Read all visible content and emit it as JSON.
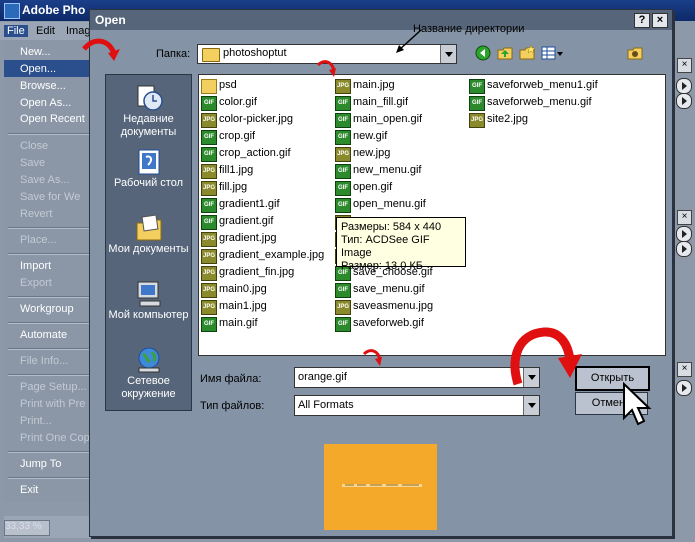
{
  "photoshop": {
    "title": "Adobe Pho",
    "menubar": [
      "File",
      "Edit",
      "Imag"
    ],
    "menu": [
      {
        "label": "New...",
        "enabled": true
      },
      {
        "label": "Open...",
        "enabled": true
      },
      {
        "label": "Browse...",
        "enabled": true
      },
      {
        "label": "Open As...",
        "enabled": true
      },
      {
        "label": "Open Recent",
        "enabled": true
      },
      {
        "label": "Close",
        "enabled": false
      },
      {
        "label": "Save",
        "enabled": false
      },
      {
        "label": "Save As...",
        "enabled": false
      },
      {
        "label": "Save for We",
        "enabled": false
      },
      {
        "label": "Revert",
        "enabled": false
      },
      {
        "label": "Place...",
        "enabled": false
      },
      {
        "label": "Import",
        "enabled": true
      },
      {
        "label": "Export",
        "enabled": false
      },
      {
        "label": "Workgroup",
        "enabled": true
      },
      {
        "label": "Automate",
        "enabled": true
      },
      {
        "label": "File Info...",
        "enabled": false
      },
      {
        "label": "Page Setup...",
        "enabled": false
      },
      {
        "label": "Print with Pre",
        "enabled": false
      },
      {
        "label": "Print...",
        "enabled": false
      },
      {
        "label": "Print One Cop",
        "enabled": false
      },
      {
        "label": "Jump To",
        "enabled": true
      },
      {
        "label": "Exit",
        "enabled": true
      }
    ],
    "zoom": "33,33 %"
  },
  "dialog": {
    "title": "Open",
    "help_btn": "?",
    "close_btn": "×",
    "look_in_label": "Папка:",
    "look_in_value": "photoshoptut",
    "annotation": "Название директории",
    "places": [
      {
        "label": "Недавние документы",
        "icon": "recent-documents-icon"
      },
      {
        "label": "Рабочий стол",
        "icon": "desktop-icon"
      },
      {
        "label": "Мои документы",
        "icon": "my-documents-icon"
      },
      {
        "label": "Мой компьютер",
        "icon": "my-computer-icon"
      },
      {
        "label": "Сетевое окружение",
        "icon": "network-icon"
      }
    ],
    "files_col1": [
      {
        "name": "psd",
        "type": "folder"
      },
      {
        "name": "color.gif",
        "type": "gif"
      },
      {
        "name": "color-picker.jpg",
        "type": "jpg"
      },
      {
        "name": "crop.gif",
        "type": "gif"
      },
      {
        "name": "crop_action.gif",
        "type": "gif"
      },
      {
        "name": "fill1.jpg",
        "type": "jpg"
      },
      {
        "name": "fill.jpg",
        "type": "jpg"
      },
      {
        "name": "gradient1.gif",
        "type": "gif"
      },
      {
        "name": "gradient.gif",
        "type": "gif"
      },
      {
        "name": "gradient.jpg",
        "type": "jpg"
      },
      {
        "name": "gradient_example.jpg",
        "type": "jpg"
      },
      {
        "name": "gradient_fin.jpg",
        "type": "jpg"
      },
      {
        "name": "main0.jpg",
        "type": "jpg"
      },
      {
        "name": "main1.jpg",
        "type": "jpg"
      },
      {
        "name": "main.gif",
        "type": "gif"
      }
    ],
    "files_col2": [
      {
        "name": "main.jpg",
        "type": "jpg"
      },
      {
        "name": "main_fill.gif",
        "type": "gif"
      },
      {
        "name": "main_open.gif",
        "type": "gif"
      },
      {
        "name": "new.gif",
        "type": "gif"
      },
      {
        "name": "new.jpg",
        "type": "jpg"
      },
      {
        "name": "new_menu.gif",
        "type": "gif"
      },
      {
        "name": "open.gif",
        "type": "gif"
      },
      {
        "name": "open_menu.gif",
        "type": "gif"
      },
      {
        "name": "",
        "type": "jpg"
      },
      {
        "name": "",
        "type": "jpg"
      },
      {
        "name": "",
        "type": "jpg"
      },
      {
        "name": "save_choose.gif",
        "type": "gif"
      },
      {
        "name": "save_menu.gif",
        "type": "gif"
      },
      {
        "name": "saveasmenu.jpg",
        "type": "jpg"
      },
      {
        "name": "saveforweb.gif",
        "type": "gif"
      }
    ],
    "files_col3": [
      {
        "name": "saveforweb_menu1.gif",
        "type": "gif"
      },
      {
        "name": "saveforweb_menu.gif",
        "type": "gif"
      },
      {
        "name": "site2.jpg",
        "type": "jpg"
      }
    ],
    "tooltip": {
      "size": "Размеры: 584 x 440",
      "type": "Тип: ACDSee GIF Image",
      "filesize": "Размер: 13,0 КБ"
    },
    "file_name_label": "Имя файла:",
    "file_name_value": "orange.gif",
    "file_type_label": "Тип файлов:",
    "file_type_value": "All Formats",
    "open_button": "Открыть",
    "cancel_button": "Отмена"
  }
}
